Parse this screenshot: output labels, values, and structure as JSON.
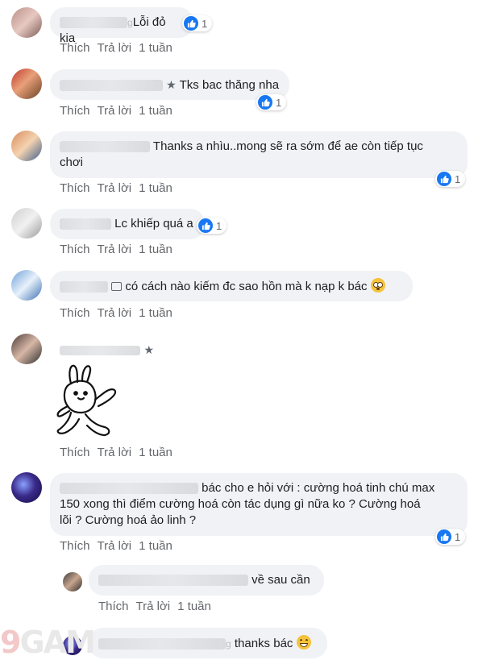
{
  "actions": {
    "like": "Thích",
    "reply": "Trả lời",
    "time": "1 tuần"
  },
  "comments": [
    {
      "text": "Lỗi đỏ kia",
      "reactions": "1",
      "name_mark": "g"
    },
    {
      "text": "Tks bac thăng nha",
      "reactions": "1"
    },
    {
      "text_line1": "Thanks a nhìu..mong sẽ ra sớm để ae còn tiếp tục",
      "text_line2": "chơi",
      "reactions": "1"
    },
    {
      "text": "Lc khiếp quá a",
      "reactions": "1"
    },
    {
      "text": "có cách nào kiếm đc sao hồn mà k nạp k bác"
    },
    {
      "sticker": "bunny-sticker"
    },
    {
      "text_line1": "bác cho e hỏi với : cường hoá tinh chú max",
      "text_line2": "150 xong thì điểm cường hoá còn tác dụng gì nữa ko ? Cường hoá",
      "text_line3": "lõi ? Cường hoá ảo linh ?",
      "reactions": "1"
    },
    {
      "text": "về sau cần"
    },
    {
      "text": "thanks bác",
      "name_mark": "g"
    }
  ],
  "watermark": {
    "nine": "9",
    "rest": "GAM"
  },
  "colors": {
    "like_blue": "#1877f2",
    "bubble": "#f0f2f5",
    "meta": "#65676b"
  }
}
